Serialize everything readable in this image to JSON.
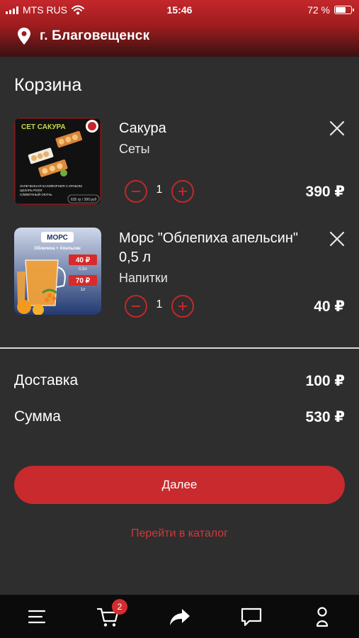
{
  "status_bar": {
    "carrier": "MTS RUS",
    "time": "15:46",
    "battery_percent": "72 %",
    "battery_level": 0.72
  },
  "header": {
    "city": "г. Благовещенск"
  },
  "cart": {
    "title": "Корзина",
    "items": [
      {
        "name": "Сакура",
        "category": "Сеты",
        "quantity": "1",
        "price": "390 ₽",
        "image": {
          "title": "СЕТ САКУРА",
          "caption": "ЗАПЕЧЕННАЯ КАЛИФОРНИЯ С КРАБОМ\nЦЕЗАРЬ РОЛЛ\nСЛИВОЧНЫЙ ОКУНЬ",
          "weight": "635 гр / 390 руб"
        }
      },
      {
        "name": "Морс \"Облепиха апельсин\" 0,5 л",
        "category": "Напитки",
        "quantity": "1",
        "price": "40 ₽",
        "image": {
          "title": "МОРС",
          "subtitle": "Облепиха + Апельсин",
          "price_small": "40 ₽",
          "volume_small": "0,5л",
          "price_large": "70 ₽",
          "volume_large": "1л"
        }
      }
    ]
  },
  "summary": {
    "delivery_label": "Доставка",
    "delivery_value": "100 ₽",
    "total_label": "Сумма",
    "total_value": "530 ₽"
  },
  "actions": {
    "next_label": "Далее",
    "catalog_label": "Перейти в каталог"
  },
  "tab_bar": {
    "cart_badge": "2",
    "icons": [
      "menu-icon",
      "cart-icon",
      "share-icon",
      "chat-icon",
      "profile-icon"
    ]
  },
  "colors": {
    "accent": "#c82a2e",
    "background": "#2e2e2e",
    "tab_bar": "#0b0b0b"
  }
}
